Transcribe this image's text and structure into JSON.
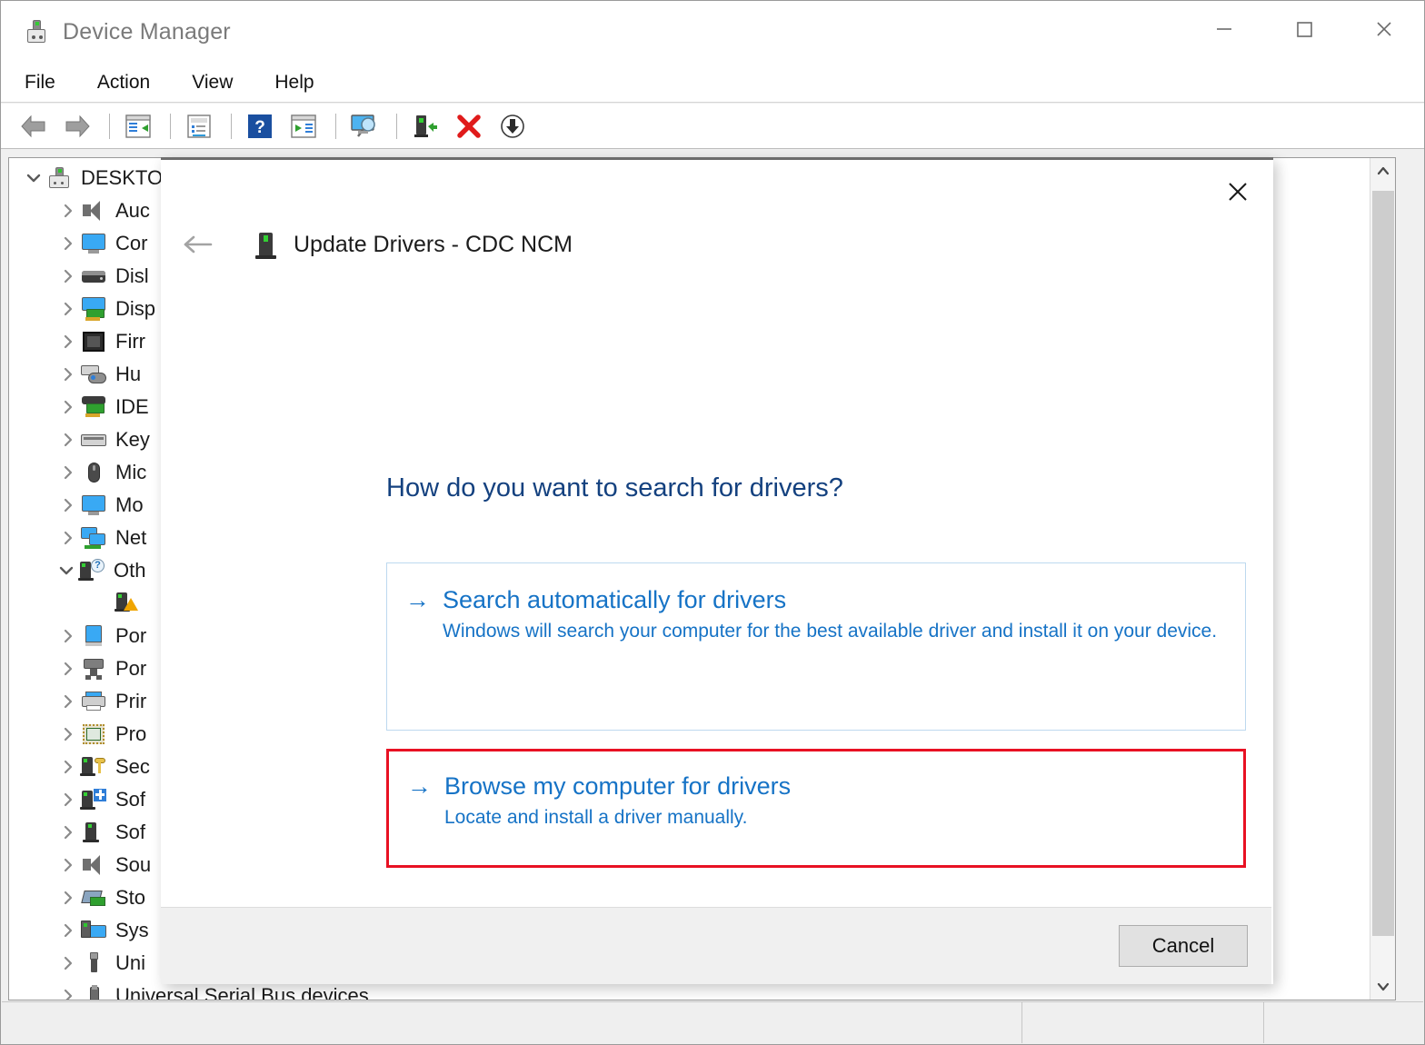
{
  "window": {
    "title": "Device Manager",
    "icon": "device-manager-icon",
    "controls": {
      "minimize": "minimize-icon",
      "maximize": "maximize-icon",
      "close": "close-icon"
    }
  },
  "menubar": {
    "items": [
      {
        "label": "File"
      },
      {
        "label": "Action"
      },
      {
        "label": "View"
      },
      {
        "label": "Help"
      }
    ]
  },
  "toolbar": {
    "buttons": [
      {
        "name": "back-button",
        "icon": "back-arrow-icon"
      },
      {
        "name": "forward-button",
        "icon": "forward-arrow-icon"
      },
      {
        "name": "show-hide-console-tree-button",
        "icon": "console-tree-icon"
      },
      {
        "name": "properties-button",
        "icon": "properties-icon"
      },
      {
        "name": "help-button",
        "icon": "help-question-icon"
      },
      {
        "name": "update-driver-button",
        "icon": "update-driver-icon"
      },
      {
        "name": "scan-for-hardware-changes-button",
        "icon": "scan-monitor-icon"
      },
      {
        "name": "enable-device-button",
        "icon": "enable-device-icon"
      },
      {
        "name": "uninstall-device-button",
        "icon": "red-x-icon"
      },
      {
        "name": "download-button",
        "icon": "download-arrow-icon"
      }
    ]
  },
  "tree": {
    "root": {
      "label": "DESKTO",
      "expanded": true,
      "icon": "computer-icon"
    },
    "nodes": [
      {
        "label": "Auc",
        "icon": "audio-icon",
        "expanded": false
      },
      {
        "label": "Cor",
        "icon": "monitor-icon",
        "expanded": false
      },
      {
        "label": "Disl",
        "icon": "disk-drive-icon",
        "expanded": false
      },
      {
        "label": "Disp",
        "icon": "display-adapter-icon",
        "expanded": false
      },
      {
        "label": "Firr",
        "icon": "firmware-chip-icon",
        "expanded": false
      },
      {
        "label": "Hu",
        "icon": "human-interface-icon",
        "expanded": false
      },
      {
        "label": "IDE",
        "icon": "ide-controller-icon",
        "expanded": false
      },
      {
        "label": "Key",
        "icon": "keyboard-icon",
        "expanded": false
      },
      {
        "label": "Mic",
        "icon": "mouse-icon",
        "expanded": false
      },
      {
        "label": "Mo",
        "icon": "monitor-icon",
        "expanded": false
      },
      {
        "label": "Net",
        "icon": "network-adapter-icon",
        "expanded": false
      },
      {
        "label": "Oth",
        "icon": "other-devices-icon",
        "expanded": true
      },
      {
        "label": "",
        "icon": "unknown-device-warning-icon",
        "expanded": null
      },
      {
        "label": "Por",
        "icon": "portable-device-icon",
        "expanded": false
      },
      {
        "label": "Por",
        "icon": "ports-icon",
        "expanded": false
      },
      {
        "label": "Prir",
        "icon": "printer-icon",
        "expanded": false
      },
      {
        "label": "Pro",
        "icon": "processor-icon",
        "expanded": false
      },
      {
        "label": "Sec",
        "icon": "security-device-icon",
        "expanded": false
      },
      {
        "label": "Sof",
        "icon": "software-component-icon",
        "expanded": false
      },
      {
        "label": "Sof",
        "icon": "software-device-icon",
        "expanded": false
      },
      {
        "label": "Sou",
        "icon": "sound-controller-icon",
        "expanded": false
      },
      {
        "label": "Sto",
        "icon": "storage-controller-icon",
        "expanded": false
      },
      {
        "label": "Sys",
        "icon": "system-device-icon",
        "expanded": false
      },
      {
        "label": "Uni",
        "icon": "usb-controller-icon",
        "expanded": false
      },
      {
        "label": "Universal Serial Bus devices",
        "icon": "usb-device-icon",
        "expanded": false
      }
    ]
  },
  "dialog": {
    "title": "Update Drivers - CDC NCM",
    "title_icon": "device-icon",
    "back_icon": "back-arrow-icon",
    "close_icon": "close-icon",
    "heading": "How do you want to search for drivers?",
    "options": [
      {
        "name": "search-automatically-option",
        "arrow": "→",
        "title": "Search automatically for drivers",
        "description": "Windows will search your computer for the best available driver and install it on your device.",
        "highlighted": false
      },
      {
        "name": "browse-my-computer-option",
        "arrow": "→",
        "title": "Browse my computer for drivers",
        "description": "Locate and install a driver manually.",
        "highlighted": true
      }
    ],
    "cancel_label": "Cancel"
  },
  "statusbar": {
    "pane1": "",
    "pane2": "",
    "pane3": ""
  },
  "colors": {
    "link_blue": "#1673c6",
    "heading_blue": "#14417f",
    "highlight_red": "#e81123",
    "option_border_blue": "#bdd9ef"
  }
}
